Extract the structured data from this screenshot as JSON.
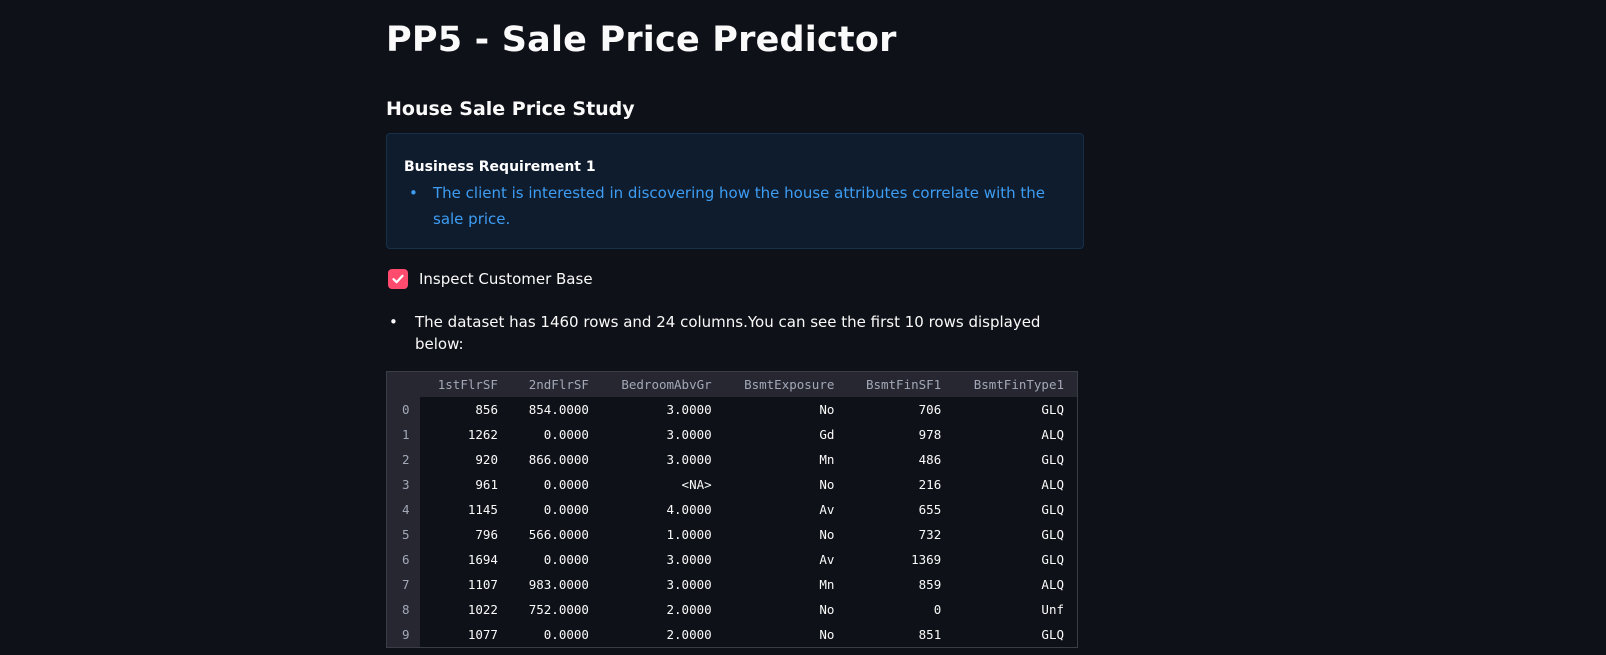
{
  "page": {
    "title": "PP5 - Sale Price Predictor",
    "section_title": "House Sale Price Study"
  },
  "info_box": {
    "heading": "Business Requirement 1",
    "items": [
      "The client is interested in discovering how the house attributes correlate with the sale price."
    ]
  },
  "checkbox": {
    "label": "Inspect Customer Base",
    "checked": true,
    "color": "#ff4b6e"
  },
  "dataset_text": "The dataset has 1460 rows and 24 columns.You can see the first 10 rows displayed below:",
  "table": {
    "columns": [
      "1stFlrSF",
      "2ndFlrSF",
      "BedroomAbvGr",
      "BsmtExposure",
      "BsmtFinSF1",
      "BsmtFinType1"
    ],
    "rows": [
      {
        "index": "0",
        "cells": [
          "856",
          "854.0000",
          "3.0000",
          "No",
          "706",
          "GLQ"
        ]
      },
      {
        "index": "1",
        "cells": [
          "1262",
          "0.0000",
          "3.0000",
          "Gd",
          "978",
          "ALQ"
        ]
      },
      {
        "index": "2",
        "cells": [
          "920",
          "866.0000",
          "3.0000",
          "Mn",
          "486",
          "GLQ"
        ]
      },
      {
        "index": "3",
        "cells": [
          "961",
          "0.0000",
          "<NA>",
          "No",
          "216",
          "ALQ"
        ]
      },
      {
        "index": "4",
        "cells": [
          "1145",
          "0.0000",
          "4.0000",
          "Av",
          "655",
          "GLQ"
        ]
      },
      {
        "index": "5",
        "cells": [
          "796",
          "566.0000",
          "1.0000",
          "No",
          "732",
          "GLQ"
        ]
      },
      {
        "index": "6",
        "cells": [
          "1694",
          "0.0000",
          "3.0000",
          "Av",
          "1369",
          "GLQ"
        ]
      },
      {
        "index": "7",
        "cells": [
          "1107",
          "983.0000",
          "3.0000",
          "Mn",
          "859",
          "ALQ"
        ]
      },
      {
        "index": "8",
        "cells": [
          "1022",
          "752.0000",
          "2.0000",
          "No",
          "0",
          "Unf"
        ]
      },
      {
        "index": "9",
        "cells": [
          "1077",
          "0.0000",
          "2.0000",
          "No",
          "851",
          "GLQ"
        ]
      }
    ]
  }
}
